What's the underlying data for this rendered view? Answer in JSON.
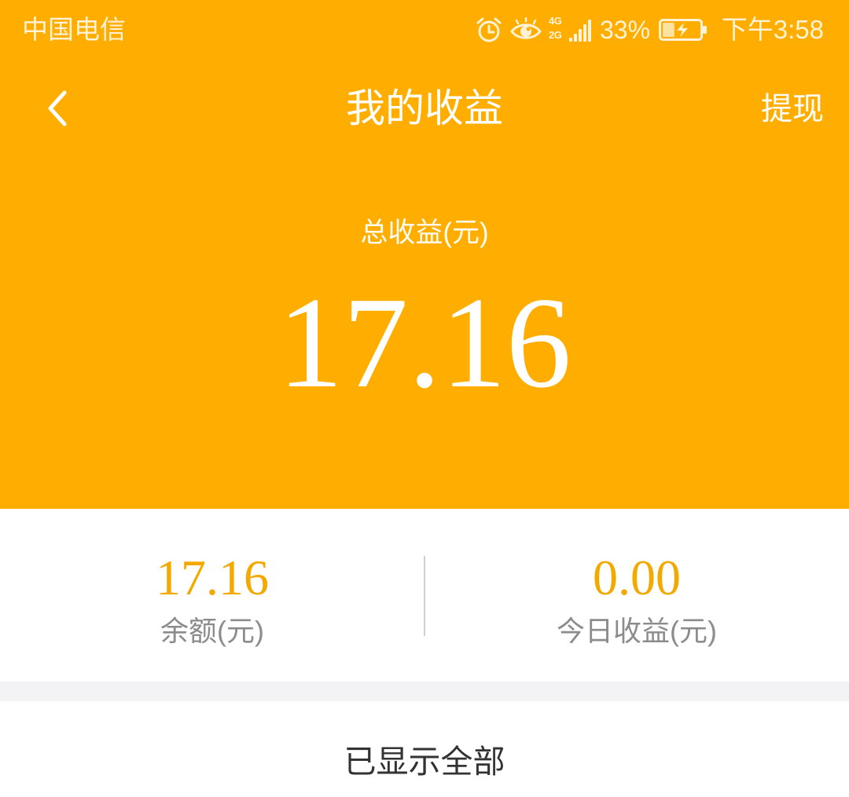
{
  "status_bar": {
    "carrier": "中国电信",
    "network": [
      "4G",
      "2G"
    ],
    "battery_percent": "33%",
    "time": "下午3:58",
    "icons": [
      "alarm-icon",
      "eye-icon",
      "signal-icon",
      "battery-charging-icon"
    ]
  },
  "header": {
    "back_icon": "chevron-left-icon",
    "title": "我的收益",
    "action_label": "提现"
  },
  "summary": {
    "label": "总收益(元)",
    "value": "17.16"
  },
  "stats": [
    {
      "value": "17.16",
      "label": "余额(元)"
    },
    {
      "value": "0.00",
      "label": "今日收益(元)"
    }
  ],
  "footer": {
    "text": "已显示全部"
  },
  "colors": {
    "accent": "#FFAE00",
    "stat_value": "#F2A900",
    "label": "#8C8C8C",
    "footer_text": "#333333",
    "band": "#F3F3F5"
  }
}
